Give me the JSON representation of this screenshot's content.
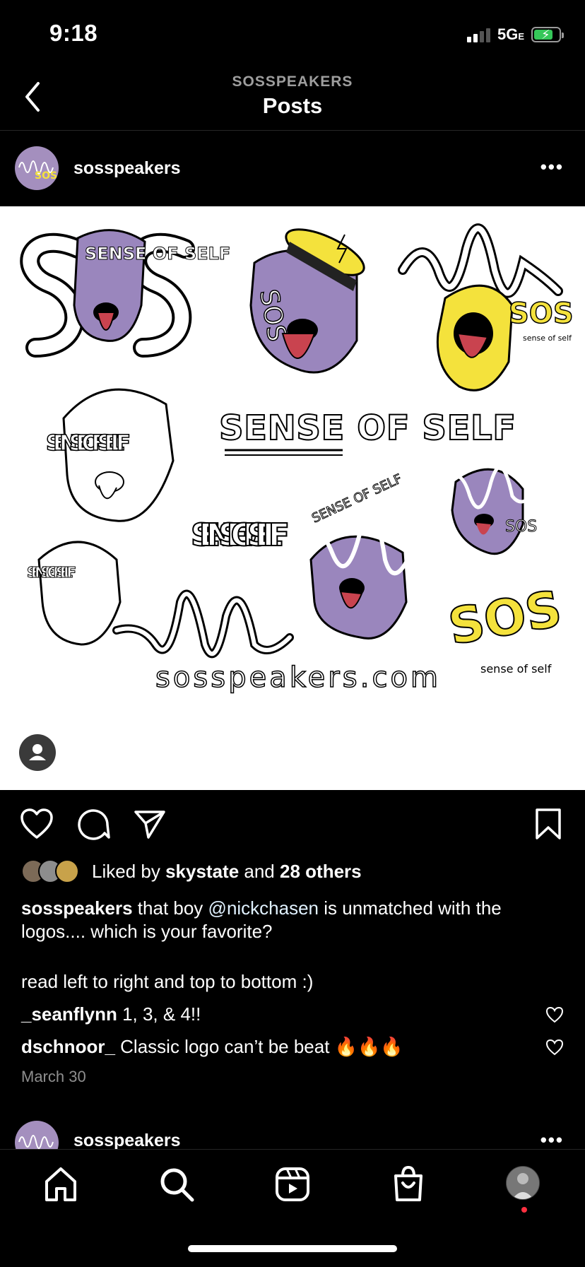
{
  "status_bar": {
    "time": "9:18",
    "network": "5G",
    "network_suffix": "E",
    "battery_color": "#35c759"
  },
  "nav": {
    "subtitle": "SOSSPEAKERS",
    "title": "Posts",
    "back_icon": "chevron-left-icon"
  },
  "post": {
    "username": "sosspeakers",
    "more_icon": "more-horizontal-icon",
    "image": {
      "texts": {
        "s_left": "S",
        "s_right": "S",
        "head1_text": "SENSE OF SELF",
        "head2_text": "SOS",
        "head3_text": "SOS",
        "head3_small": "sense of self",
        "head4_text": "SENSE OF SELF",
        "wordmark": "SENSE OF SELF",
        "stack_text": "SENSE OF SELF",
        "head5_text": "SENSE OF SELF",
        "head6_text": "SOS",
        "head7_text": "SENSE OF SELF",
        "yellow_sos": "SOS",
        "yellow_small": "sense of self",
        "url": "sosspeakers.com"
      },
      "tag_icon": "person-icon"
    },
    "actions": {
      "like_icon": "heart-icon",
      "comment_icon": "comment-icon",
      "share_icon": "send-icon",
      "save_icon": "bookmark-icon"
    },
    "likes": {
      "prefix": "Liked by",
      "user": "skystate",
      "conj": "and",
      "others": "28 others"
    },
    "caption": {
      "user": "sosspeakers",
      "text_before": "that boy",
      "mention": "@nickchasen",
      "text_after": "is unmatched with the logos.... which is your favorite?",
      "line2": "read left to right and top to bottom :)"
    },
    "comments": [
      {
        "user": "_seanflynn",
        "text": "1, 3, & 4!!"
      },
      {
        "user": "dschnoor_",
        "text": "Classic logo can’t be beat 🔥🔥🔥"
      }
    ],
    "date": "March 30"
  },
  "next_post": {
    "username": "sosspeakers"
  },
  "tabbar": {
    "home": "home-icon",
    "search": "search-icon",
    "reels": "reels-icon",
    "shop": "shop-bag-icon",
    "profile": "profile-avatar"
  },
  "colors": {
    "purple": "#9a86bd",
    "yellow": "#f4e23c",
    "tongue": "#c9434f"
  }
}
